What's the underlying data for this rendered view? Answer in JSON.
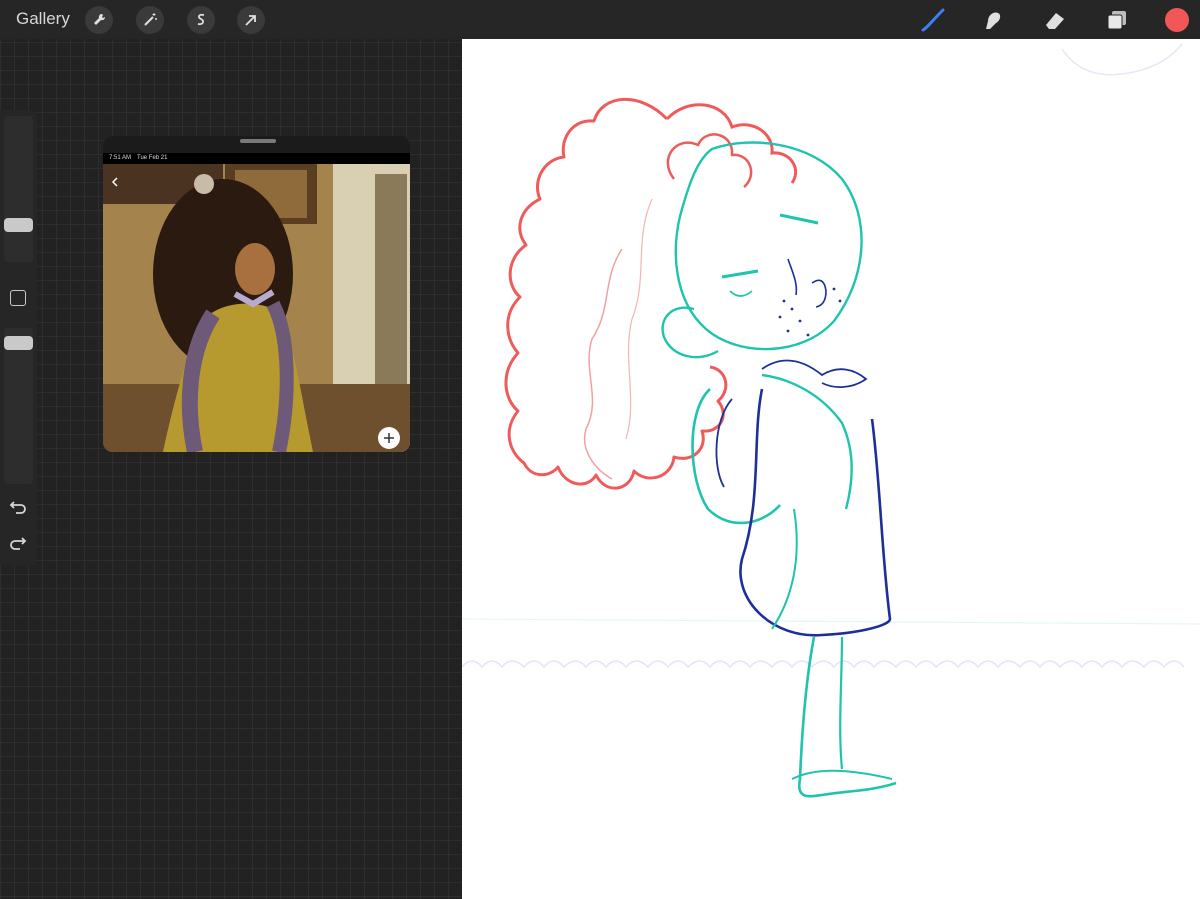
{
  "topbar": {
    "gallery_label": "Gallery",
    "left_tools": [
      "wrench-icon",
      "magic-wand-icon",
      "selection-icon",
      "transform-arrow-icon"
    ],
    "right_tools": [
      "brush-icon",
      "smudge-icon",
      "eraser-icon",
      "layers-icon"
    ],
    "active_tool": "brush-icon",
    "brush_color": "#f15757",
    "accent_color": "#3d7ff0"
  },
  "sidebar": {
    "brush_size": 0.56,
    "opacity": 0.94,
    "modify_button": "square-modify-icon",
    "undo": "undo-icon",
    "redo": "redo-icon"
  },
  "reference": {
    "status_time": "7:51 AM",
    "status_date": "Tue Feb 21"
  },
  "sketch_colors": {
    "hair": "#ef5b5b",
    "body": "#1ec4ac",
    "dress": "#1d2f98"
  }
}
